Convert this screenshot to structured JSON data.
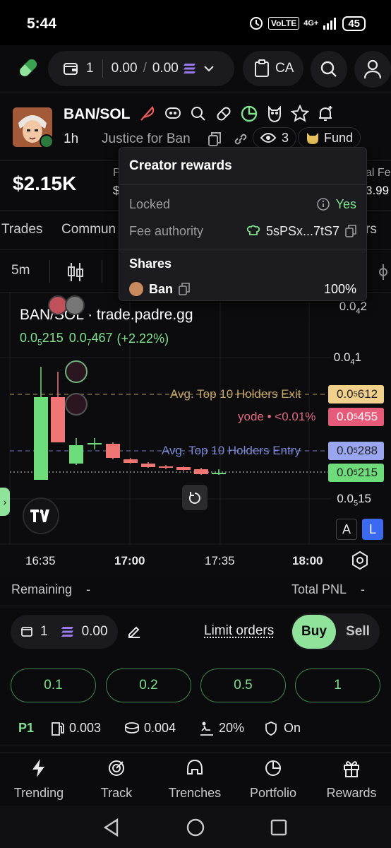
{
  "status": {
    "time": "5:44",
    "volte": "VoLTE",
    "net": "4G+",
    "battery": "45"
  },
  "topbar": {
    "wallet_count": "1",
    "sol_balance": "0.00",
    "sep": "/",
    "sol_balance2": "0.00",
    "ca_label": "CA"
  },
  "token": {
    "pair": "BAN/SOL",
    "timeframe": "1h",
    "name": "Justice for Ban",
    "holders_icon_count": "3",
    "fund_label": "Fund"
  },
  "price": {
    "mcap": "$2.15K",
    "partial_label_left": "P",
    "partial_value_left": "$",
    "partial_label_right": "al Fe",
    "partial_value_right": "3.99"
  },
  "tabs": {
    "trades": "Trades",
    "community": "Commun",
    "right": "rs"
  },
  "chartbar": {
    "interval": "5m"
  },
  "popup": {
    "title": "Creator rewards",
    "locked_label": "Locked",
    "locked_value": "Yes",
    "fee_label": "Fee authority",
    "fee_value": "5sPSx...7tS7",
    "shares_title": "Shares",
    "share_name": "Ban",
    "share_pct": "100%"
  },
  "chart": {
    "title": "BAN/SOL · trade.padre.gg",
    "ohlc_a": "0.0",
    "ohlc_a_sub": "5",
    "ohlc_a_end": "215",
    "ohlc_b": "0.0",
    "ohlc_b_sub": "7",
    "ohlc_b_end": "467",
    "change": "(+2.22%)",
    "y_top": {
      "pre": "0.0",
      "sub": "4",
      "post": "2"
    },
    "y_mid": {
      "pre": "0.0",
      "sub": "4",
      "post": "1"
    },
    "y_low": {
      "pre": "0.0",
      "sub": "5",
      "post": "15"
    },
    "exit_label": "Avg. Top 10 Holders Exit",
    "exit_tag": {
      "pre": "0.0",
      "sub": "5",
      "post": "612"
    },
    "yode_label": "yode • <0.01%",
    "yode_tag": {
      "pre": "0.0",
      "sub": "5",
      "post": "455"
    },
    "entry_label": "Avg. Top 10 Holders Entry",
    "entry_tag": {
      "pre": "0.0",
      "sub": "5",
      "post": "288"
    },
    "last_tag": {
      "pre": "0.0",
      "sub": "5",
      "post": "215"
    },
    "x_ticks": [
      "16:35",
      "17:00",
      "17:35",
      "18:00"
    ],
    "btn_a": "A",
    "btn_l": "L",
    "colors": {
      "up": "#6fdc7c",
      "down": "#f07575",
      "exit": "#f0d08a",
      "yode": "#e65a7a",
      "entry": "#9aa6ef"
    }
  },
  "remaining": {
    "label": "Remaining",
    "value": "-",
    "pnl_label": "Total PNL",
    "pnl_value": "-"
  },
  "controls": {
    "wallets": "1",
    "sol": "0.00",
    "limit": "Limit orders",
    "buy": "Buy",
    "sell": "Sell"
  },
  "amounts": [
    "0.1",
    "0.2",
    "0.5",
    "1"
  ],
  "stats": {
    "preset": "P1",
    "fee1": "0.003",
    "fee2": "0.004",
    "slippage": "20%",
    "mev": "On"
  },
  "nav": [
    "Trending",
    "Track",
    "Trenches",
    "Portfolio",
    "Rewards"
  ]
}
